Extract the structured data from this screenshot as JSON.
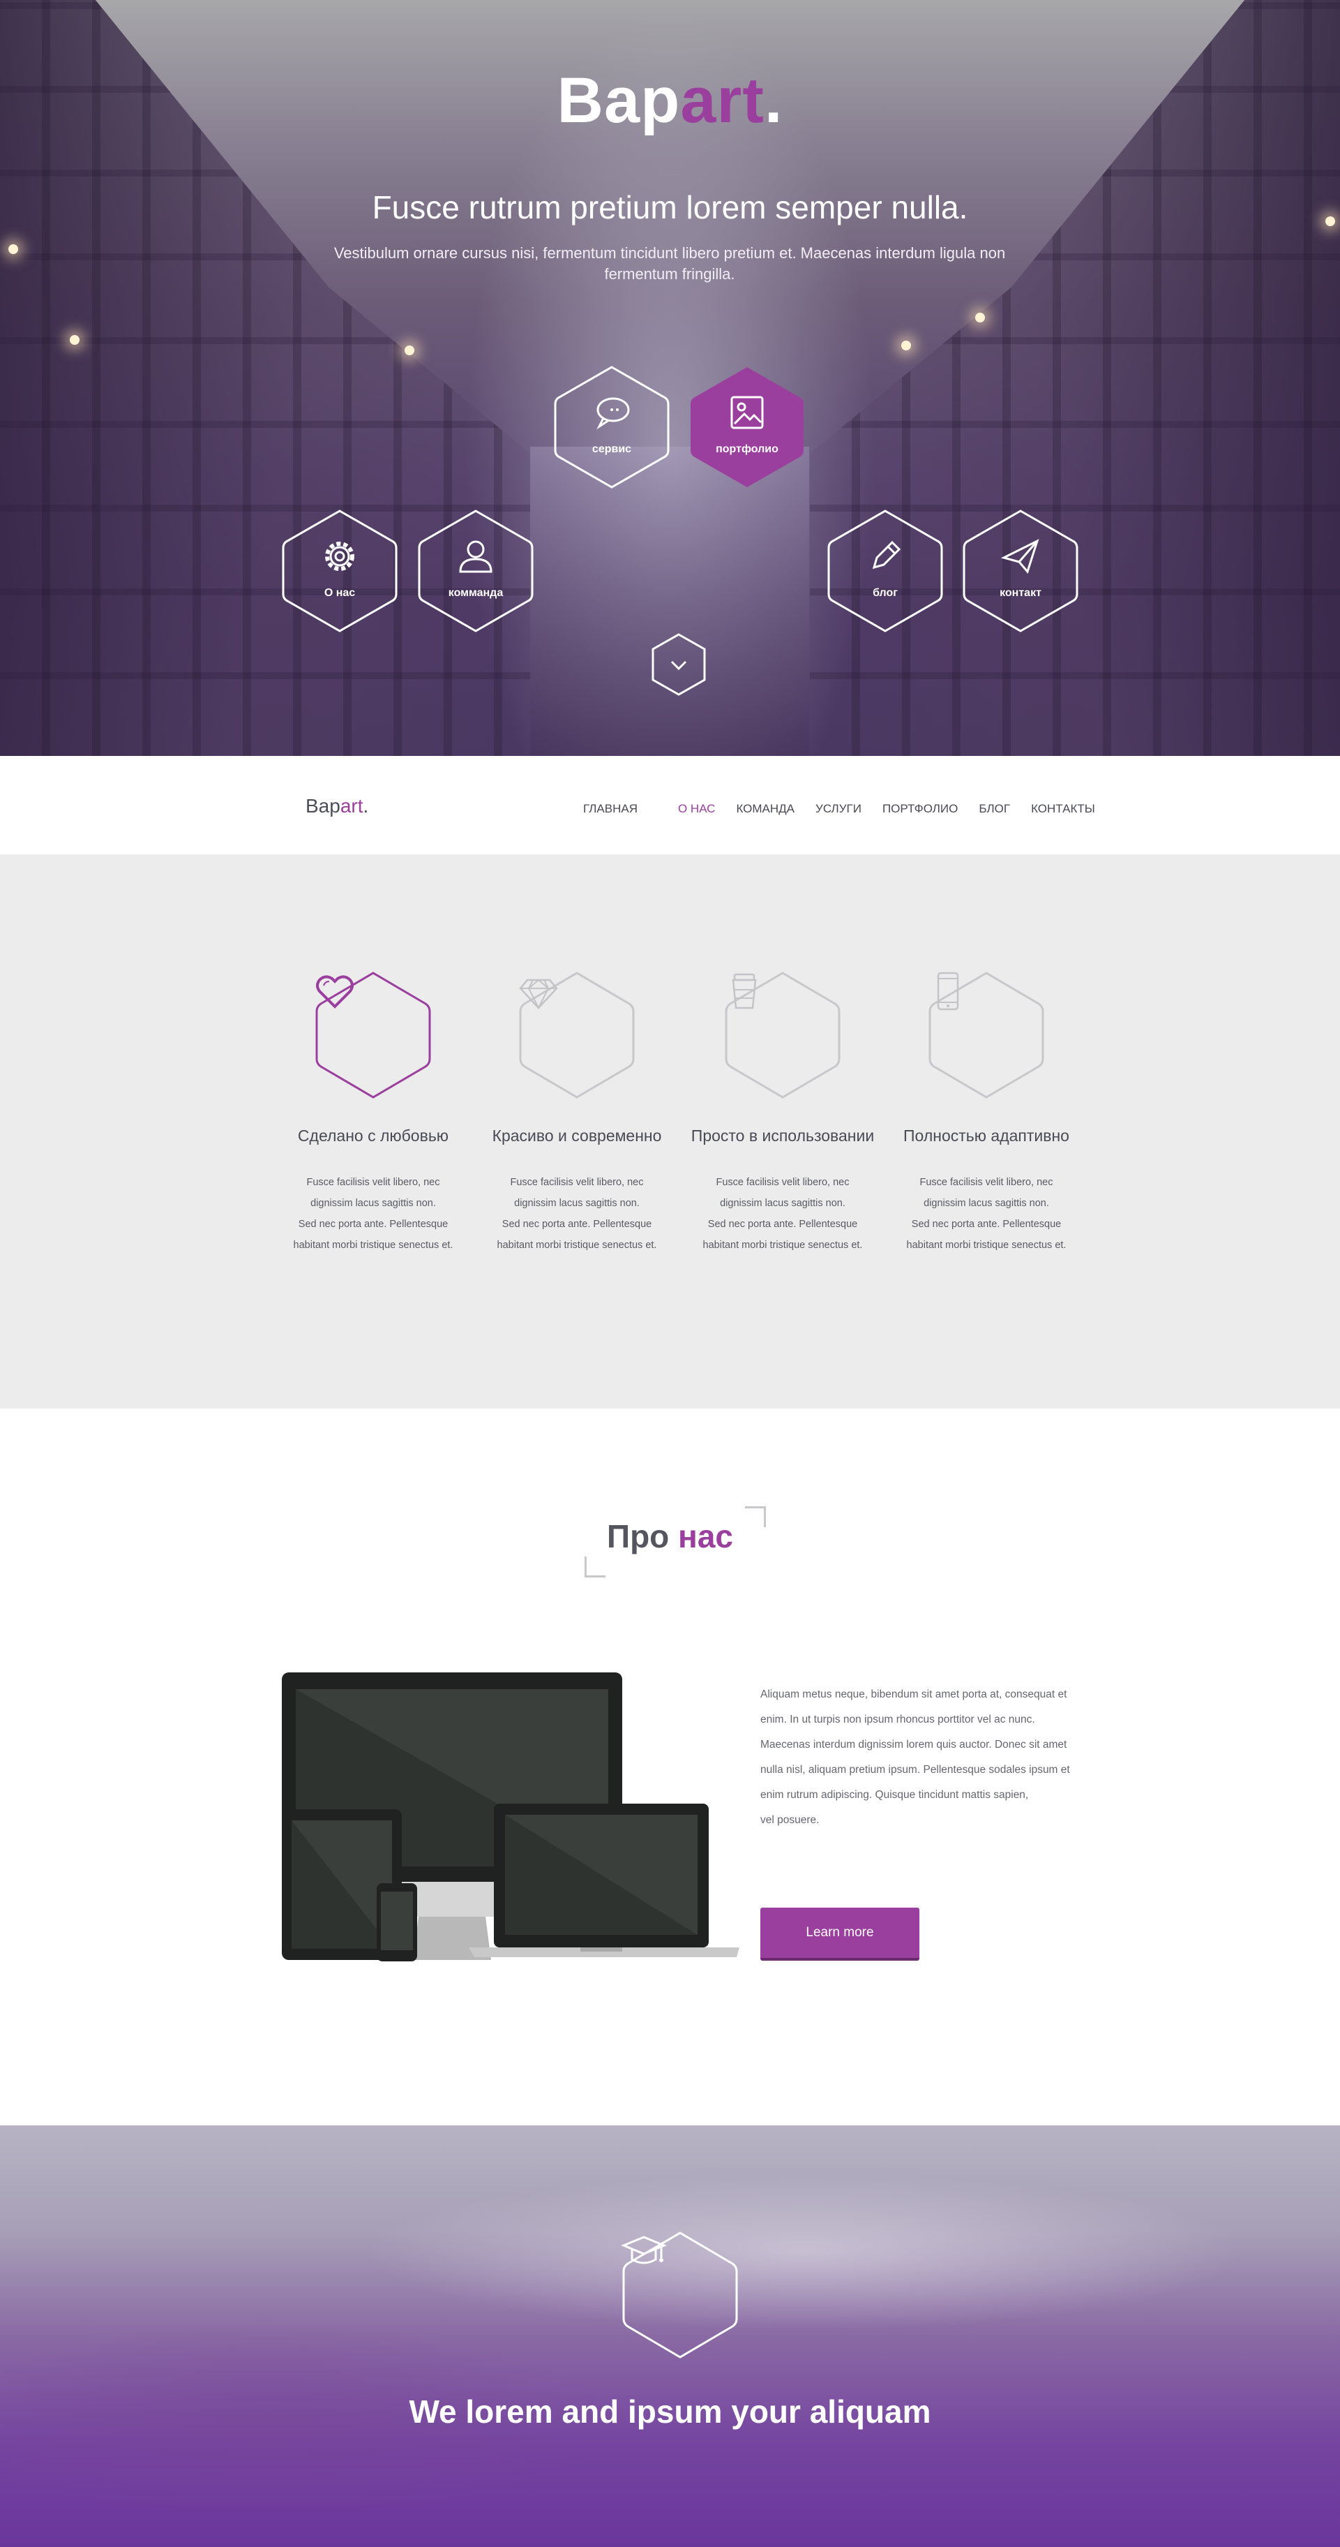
{
  "hero": {
    "logo_main": "Bap",
    "logo_accent": "art",
    "logo_dot": ".",
    "title": "Fusce rutrum pretium lorem semper nulla.",
    "subtitle": "Vestibulum ornare cursus nisi, fermentum tincidunt libero pretium et. Maecenas interdum ligula non fermentum fringilla.",
    "menu": [
      {
        "label": "сервис",
        "icon": "speech-bubble-icon",
        "active": false
      },
      {
        "label": "портфолио",
        "icon": "image-icon",
        "active": true
      },
      {
        "label": "О нас",
        "icon": "gear-icon",
        "active": false
      },
      {
        "label": "комманда",
        "icon": "user-icon",
        "active": false
      },
      {
        "label": "блог",
        "icon": "pencil-icon",
        "active": false
      },
      {
        "label": "контакт",
        "icon": "paper-plane-icon",
        "active": false
      }
    ],
    "scroll_icon": "chevron-down-icon"
  },
  "nav": {
    "brand_main": "Bap",
    "brand_accent": "art",
    "brand_dot": ".",
    "items": [
      {
        "label": "ГЛАВНАЯ",
        "active": false
      },
      {
        "label": "О НАС",
        "active": true
      },
      {
        "label": "КОМАНДА",
        "active": false
      },
      {
        "label": "УСЛУГИ",
        "active": false
      },
      {
        "label": "ПОРТФОЛИО",
        "active": false
      },
      {
        "label": "БЛОГ",
        "active": false
      },
      {
        "label": "КОНТАКТЫ",
        "active": false
      }
    ]
  },
  "features": [
    {
      "title": "Сделано с любовью",
      "icon": "heart-icon",
      "active": true,
      "line1": "Fusce facilisis velit libero, nec",
      "line2": "dignissim lacus sagittis non.",
      "line3": "Sed nec porta ante. Pellentesque",
      "line4": "habitant morbi tristique senectus et."
    },
    {
      "title": "Красиво и современно",
      "icon": "diamond-icon",
      "active": false,
      "line1": "Fusce facilisis velit libero, nec",
      "line2": "dignissim lacus sagittis non.",
      "line3": "Sed nec porta ante. Pellentesque",
      "line4": "habitant morbi tristique senectus et."
    },
    {
      "title": "Просто в использовании",
      "icon": "cup-icon",
      "active": false,
      "line1": "Fusce facilisis velit libero, nec",
      "line2": "dignissim lacus sagittis non.",
      "line3": "Sed nec porta ante. Pellentesque",
      "line4": "habitant morbi tristique senectus et."
    },
    {
      "title": "Полностью адаптивно",
      "icon": "phone-icon",
      "active": false,
      "line1": "Fusce facilisis velit libero, nec",
      "line2": "dignissim lacus sagittis non.",
      "line3": "Sed nec porta ante. Pellentesque",
      "line4": "habitant morbi tristique senectus et."
    }
  ],
  "about": {
    "heading_main": "Про ",
    "heading_accent": "нас",
    "lines": [
      "Aliquam metus neque, bibendum sit amet porta at, consequat et",
      "enim. In ut turpis non ipsum rhoncus porttitor vel ac nunc.",
      "Maecenas interdum dignissim lorem quis auctor. Donec sit amet",
      "nulla nisl, aliquam pretium ipsum. Pellentesque sodales ipsum et",
      "enim rutrum adipiscing. Quisque tincidunt mattis sapien,",
      "vel posuere."
    ],
    "button": "Learn more"
  },
  "bottom": {
    "icon": "graduation-cap-icon",
    "tagline": "We lorem and ipsum your aliquam"
  },
  "colors": {
    "accent": "#9b3f9e",
    "text_dark": "#4a4a55",
    "features_bg": "#ececec"
  }
}
